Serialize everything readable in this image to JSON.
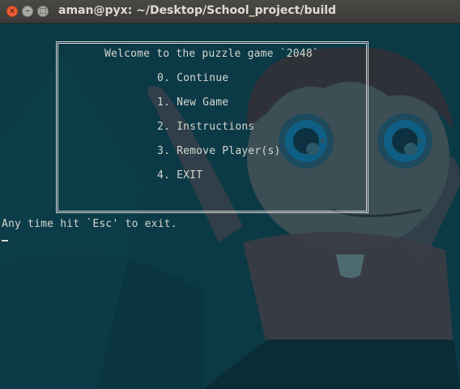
{
  "window": {
    "title": "aman@pyx: ~/Desktop/School_project/build",
    "close_glyph": "×",
    "minimize_glyph": "–",
    "maximize_glyph": "□"
  },
  "menu": {
    "title": "Welcome to the puzzle game `2048`",
    "items": [
      "0. Continue",
      "1. New Game",
      "2. Instructions",
      "3. Remove Player(s)",
      "4. EXIT"
    ]
  },
  "terminal": {
    "hint": "Any time hit `Esc' to exit."
  },
  "colors": {
    "background": "#0c3946",
    "text": "#d3d7cf",
    "close_button": "#ef5d34"
  }
}
